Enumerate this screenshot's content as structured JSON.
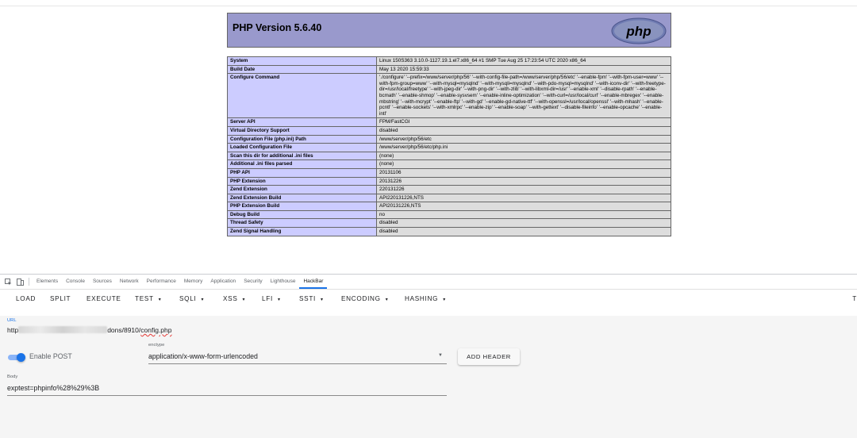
{
  "php": {
    "title": "PHP Version 5.6.40",
    "logo_text": "php",
    "rows": [
      {
        "key": "System",
        "value": "Linux 150S363 3.10.0-1127.19.1.el7.x86_64 #1 SMP Tue Aug 25 17:23:54 UTC 2020 x86_64"
      },
      {
        "key": "Build Date",
        "value": "May 13 2020 15:59:33"
      },
      {
        "key": "Configure Command",
        "value": "'./configure' '--prefix=/www/server/php/56' '--with-config-file-path=/www/server/php/56/etc' '--enable-fpm' '--with-fpm-user=www' '--with-fpm-group=www' '--with-mysql=mysqlnd' '--with-mysqli=mysqlnd' '--with-pdo-mysql=mysqlnd' '--with-iconv-dir' '--with-freetype-dir=/usr/local/freetype' '--with-jpeg-dir' '--with-png-dir' '--with-zlib' '--with-libxml-dir=/usr' '--enable-xml' '--disable-rpath' '--enable-bcmath' '--enable-shmop' '--enable-sysvsem' '--enable-inline-optimization' '--with-curl=/usr/local/curl' '--enable-mbregex' '--enable-mbstring' '--with-mcrypt' '--enable-ftp' '--with-gd' '--enable-gd-native-ttf' '--with-openssl=/usr/local/openssl' '--with-mhash' '--enable-pcntl' '--enable-sockets' '--with-xmlrpc' '--enable-zip' '--enable-soap' '--with-gettext' '--disable-fileinfo' '--enable-opcache' '--enable-intl'"
      },
      {
        "key": "Server API",
        "value": "FPM/FastCGI"
      },
      {
        "key": "Virtual Directory Support",
        "value": "disabled"
      },
      {
        "key": "Configuration File (php.ini) Path",
        "value": "/www/server/php/56/etc"
      },
      {
        "key": "Loaded Configuration File",
        "value": "/www/server/php/56/etc/php.ini"
      },
      {
        "key": "Scan this dir for additional .ini files",
        "value": "(none)"
      },
      {
        "key": "Additional .ini files parsed",
        "value": "(none)"
      },
      {
        "key": "PHP API",
        "value": "20131106"
      },
      {
        "key": "PHP Extension",
        "value": "20131226"
      },
      {
        "key": "Zend Extension",
        "value": "220131226"
      },
      {
        "key": "Zend Extension Build",
        "value": "API220131226,NTS"
      },
      {
        "key": "PHP Extension Build",
        "value": "API20131226,NTS"
      },
      {
        "key": "Debug Build",
        "value": "no"
      },
      {
        "key": "Thread Safety",
        "value": "disabled"
      },
      {
        "key": "Zend Signal Handling",
        "value": "disabled"
      }
    ]
  },
  "devtools": {
    "tabs": [
      "Elements",
      "Console",
      "Sources",
      "Network",
      "Performance",
      "Memory",
      "Application",
      "Security",
      "Lighthouse",
      "HackBar"
    ],
    "active_tab": "HackBar"
  },
  "hackbar": {
    "buttons": [
      {
        "label": "LOAD",
        "dropdown": false
      },
      {
        "label": "SPLIT",
        "dropdown": false
      },
      {
        "label": "EXECUTE",
        "dropdown": false
      },
      {
        "label": "TEST",
        "dropdown": true
      },
      {
        "label": "SQLI",
        "dropdown": true
      },
      {
        "label": "XSS",
        "dropdown": true
      },
      {
        "label": "LFI",
        "dropdown": true
      },
      {
        "label": "SSTI",
        "dropdown": true
      },
      {
        "label": "ENCODING",
        "dropdown": true
      },
      {
        "label": "HASHING",
        "dropdown": true
      }
    ],
    "right_cut_label": "T",
    "url_label": "URL",
    "url_prefix": "http",
    "url_suffix": "dons/8910/",
    "url_file": "config.php",
    "enable_post_label": "Enable POST",
    "enable_post": true,
    "enctype_label": "enctype",
    "enctype_value": "application/x-www-form-urlencoded",
    "add_header_label": "ADD HEADER",
    "body_label": "Body",
    "body_value": "exptest=phpinfo%28%29%3B"
  },
  "colors": {
    "php_header": "#9999cc",
    "php_key_bg": "#ccccff",
    "php_val_bg": "#dddddd",
    "accent": "#1a73e8"
  }
}
